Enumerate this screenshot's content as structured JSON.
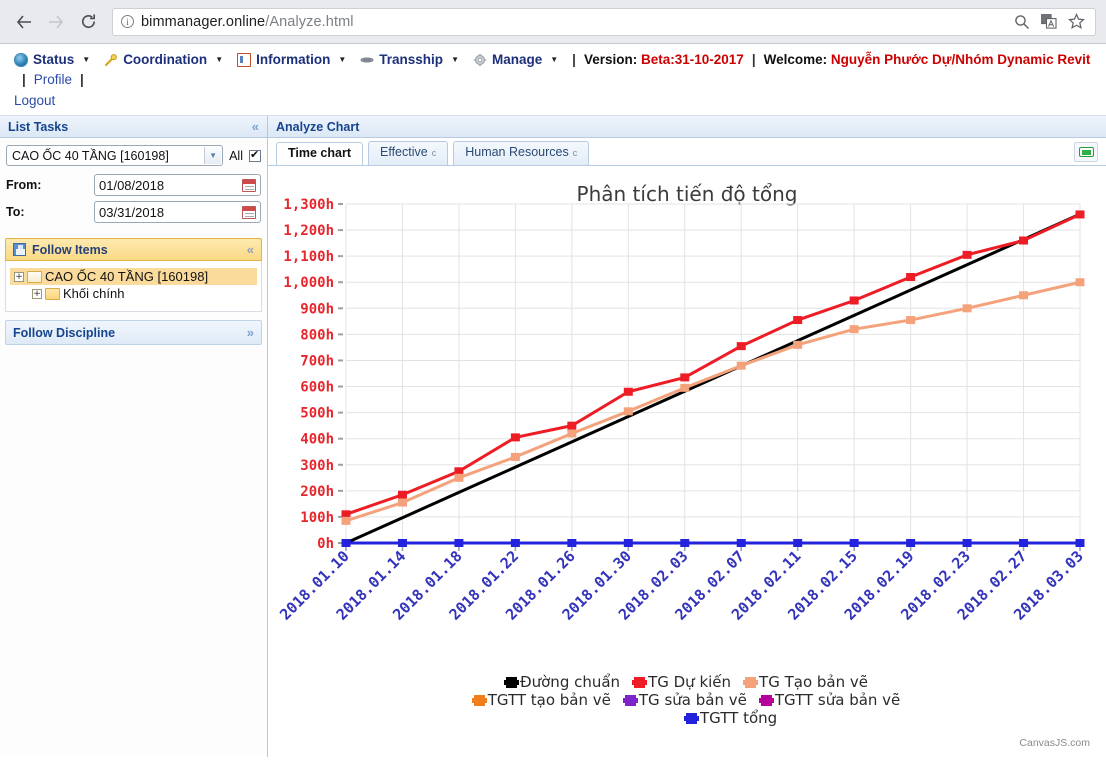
{
  "browser": {
    "back_icon": "back-arrow-icon",
    "forward_icon": "forward-arrow-icon",
    "reload_icon": "reload-icon",
    "info_glyph": "i",
    "url_host": "bimmanager.online",
    "url_path": "/Analyze.html",
    "search_icon": "search-icon",
    "translate_icon": "translate-icon",
    "bookmark_icon": "star-icon"
  },
  "appmenu": {
    "items": [
      {
        "label": "Status",
        "icon": "status-icon",
        "caret": "▼"
      },
      {
        "label": "Coordination",
        "icon": "key-icon",
        "caret": "▼"
      },
      {
        "label": "Information",
        "icon": "information-icon",
        "caret": "▼"
      },
      {
        "label": "Transship",
        "icon": "transship-icon",
        "caret": "▼"
      },
      {
        "label": "Manage",
        "icon": "gear-icon",
        "caret": "▼"
      }
    ],
    "pipe": "|",
    "version_label": "Version:",
    "version_value": "Beta:31-10-2017",
    "welcome_label": "Welcome:",
    "welcome_value": "Nguyễn Phước Dự/Nhóm Dynamic Revit",
    "profile_label": "Profile",
    "logout_label": "Logout",
    "link_color": "#1b2f7a",
    "accent_red": "#cc0000"
  },
  "sidebar": {
    "title": "List Tasks",
    "collapse_icon": "chevron-double-left-icon",
    "project_select_value": "CAO ỐC 40 TẦNG [160198]",
    "all_label": "All",
    "all_checked": true,
    "from_label": "From:",
    "from_value": "01/08/2018",
    "to_label": "To:",
    "to_value": "03/31/2018",
    "follow_items": {
      "title": "Follow Items",
      "icon": "save-disk-icon",
      "collapse_icon": "chevron-up-icon",
      "nodes": [
        {
          "label": "CAO ỐC 40 TẦNG [160198]",
          "expander": "+",
          "selected": true
        },
        {
          "label": "Khối chính",
          "expander": "+",
          "selected": false
        }
      ]
    },
    "follow_discipline": {
      "title": "Follow Discipline",
      "expand_icon": "chevron-down-icon"
    }
  },
  "main": {
    "title": "Analyze Chart",
    "tabs": [
      {
        "label": "Time chart",
        "badge": "",
        "active": true
      },
      {
        "label": "Effective",
        "badge": "c",
        "active": false
      },
      {
        "label": "Human Resources",
        "badge": "c",
        "active": false
      }
    ],
    "toggle_button_icon": "green-panel-icon",
    "credit": "CanvasJS.com"
  },
  "chart_data": {
    "type": "line",
    "title": "Phân tích tiến độ tổng",
    "xlabel": "",
    "ylabel": "",
    "ylim": [
      0,
      1300
    ],
    "ytick_suffix": "h",
    "ytick_color": "#e8262d",
    "xtick_color": "#3333bb",
    "grid": true,
    "legend_position": "bottom",
    "yticks": [
      "0h",
      "100h",
      "200h",
      "300h",
      "400h",
      "500h",
      "600h",
      "700h",
      "800h",
      "900h",
      "1,000h",
      "1,100h",
      "1,200h",
      "1,300h"
    ],
    "x": [
      "2018.01.10",
      "2018.01.14",
      "2018.01.18",
      "2018.01.22",
      "2018.01.26",
      "2018.01.30",
      "2018.02.03",
      "2018.02.07",
      "2018.02.11",
      "2018.02.15",
      "2018.02.19",
      "2018.02.23",
      "2018.02.27",
      "2018.03.03"
    ],
    "xticks_shown": [
      "2018.01.10",
      "2018.01.14",
      "2018.01.18",
      "2018.01.22",
      "2018.01.26",
      "2018.01.30",
      "2018.02.03",
      "2018.02.07",
      "2018.02.11",
      "2018.02.15",
      "2018.02.19",
      "2018.02.23",
      "2018.02.27",
      "2018.03.03"
    ],
    "series": [
      {
        "name": "Đường chuẩn",
        "color": "#000000",
        "marker": "none",
        "values": [
          0,
          97,
          194,
          291,
          388,
          485,
          582,
          679,
          776,
          873,
          970,
          1067,
          1164,
          1261
        ]
      },
      {
        "name": "TG Dự kiến",
        "color": "#ee1c25",
        "marker": "square",
        "values": [
          110,
          185,
          275,
          405,
          450,
          580,
          635,
          755,
          855,
          930,
          1020,
          1105,
          1160,
          1260
        ]
      },
      {
        "name": "TG Tạo bản vẽ",
        "color": "#f4a27c",
        "marker": "square",
        "values": [
          85,
          155,
          250,
          330,
          420,
          505,
          595,
          680,
          760,
          820,
          855,
          900,
          950,
          1000
        ]
      },
      {
        "name": "TGTT tạo bản vẽ",
        "color": "#f07f1a",
        "marker": "square",
        "values": [
          0,
          0,
          0,
          0,
          0,
          0,
          0,
          0,
          0,
          0,
          0,
          0,
          0,
          0
        ]
      },
      {
        "name": "TG sửa bản vẽ",
        "color": "#7d25c9",
        "marker": "square",
        "values": [
          0,
          0,
          0,
          0,
          0,
          0,
          0,
          0,
          0,
          0,
          0,
          0,
          0,
          0
        ]
      },
      {
        "name": "TGTT sửa bản vẽ",
        "color": "#b5009b",
        "marker": "square",
        "values": [
          0,
          0,
          0,
          0,
          0,
          0,
          0,
          0,
          0,
          0,
          0,
          0,
          0,
          0
        ]
      },
      {
        "name": "TGTT tổng",
        "color": "#2323dd",
        "marker": "square",
        "values": [
          0,
          0,
          0,
          0,
          0,
          0,
          0,
          0,
          0,
          0,
          0,
          0,
          0,
          0
        ]
      }
    ]
  }
}
